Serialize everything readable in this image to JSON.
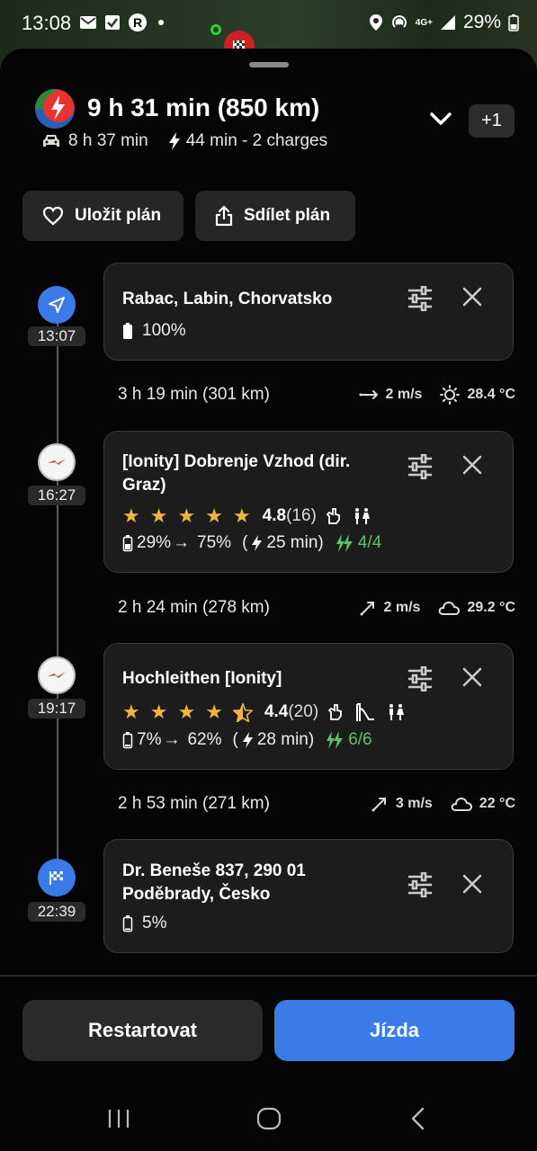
{
  "status_bar": {
    "time": "13:08",
    "battery": "29%",
    "network": "4G+"
  },
  "summary": {
    "total": "9 h 31 min (850 km)",
    "drive": "8 h 37 min",
    "charge": "44 min - 2 charges",
    "plus_badge": "+1"
  },
  "actions": {
    "save": "Uložit plán",
    "share": "Sdílet plán"
  },
  "stops": [
    {
      "time": "13:07",
      "name": "Rabac, Labin, Chorvatsko",
      "battery": "100%"
    },
    {
      "time": "16:27",
      "name": "[Ionity] Dobrenje Vzhod (dir. Graz)",
      "rating": "4.8",
      "reviews": "(16)",
      "soc_from": "29%",
      "soc_to": "75%",
      "charge_time": "25 min",
      "chargers": "4/4",
      "stars": 5
    },
    {
      "time": "19:17",
      "name": "Hochleithen [Ionity]",
      "rating": "4.4",
      "reviews": "(20)",
      "soc_from": "7%",
      "soc_to": "62%",
      "charge_time": "28 min",
      "chargers": "6/6",
      "stars": 4.5
    },
    {
      "time": "22:39",
      "name": "Dr. Beneše 837, 290 01 Poděbrady, Česko",
      "battery": "5%"
    }
  ],
  "segments": [
    {
      "duration": "3 h 19 min (301 km)",
      "wind": "2 m/s",
      "temp": "28.4 °C",
      "weather_icon": "sun-icon"
    },
    {
      "duration": "2 h 24 min (278 km)",
      "wind": "2 m/s",
      "temp": "29.2 °C",
      "weather_icon": "cloud-icon"
    },
    {
      "duration": "2 h 53 min (271 km)",
      "wind": "3 m/s",
      "temp": "22 °C",
      "weather_icon": "cloud-icon"
    }
  ],
  "bottom": {
    "restart": "Restartovat",
    "drive": "Jízda"
  },
  "colors": {
    "accent": "#3b7be8",
    "star": "#f2b33d",
    "green": "#5bc46a",
    "card": "#1c1c1c"
  }
}
